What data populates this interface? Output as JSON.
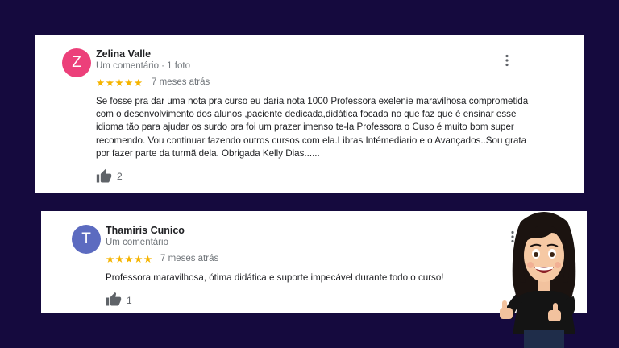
{
  "reviews": [
    {
      "initial": "Z",
      "name": "Zelina Valle",
      "meta": "Um comentário · 1 foto",
      "stars": "★★★★★",
      "rating": 5,
      "when": "7 meses atrás",
      "text": "Se fosse pra dar uma nota pra curso eu daria nota 1000 Professora exelenie maravilhosa comprometida\ncom o desenvolvimento dos alunos ,paciente dedicada,didática  focada no que faz que é ensinar esse\nidioma tão para ajudar os surdo pra foi um prazer imenso te-la Professora  o Cuso é muito bom super\nrecomendo. Vou continuar fazendo outros cursos com ela.Libras Intémediario e o Avançados..Sou grata\npor fazer parte da turmã dela. Obrigada Kelly Dias......",
      "likes": "2",
      "avatar_color": "#ec407a"
    },
    {
      "initial": "T",
      "name": "Thamiris Cunico",
      "meta": "Um comentário",
      "stars": "★★★★★",
      "rating": 5,
      "when": "7 meses atrás",
      "text": "Professora maravilhosa, ótima didática e suporte impecável durante todo o curso!",
      "likes": "1",
      "avatar_color": "#5c6bc0"
    }
  ],
  "icons": {
    "like": "thumbs-up-icon",
    "more": "more-vert-icon"
  },
  "colors": {
    "background": "#150a3e",
    "star": "#f5b400"
  }
}
